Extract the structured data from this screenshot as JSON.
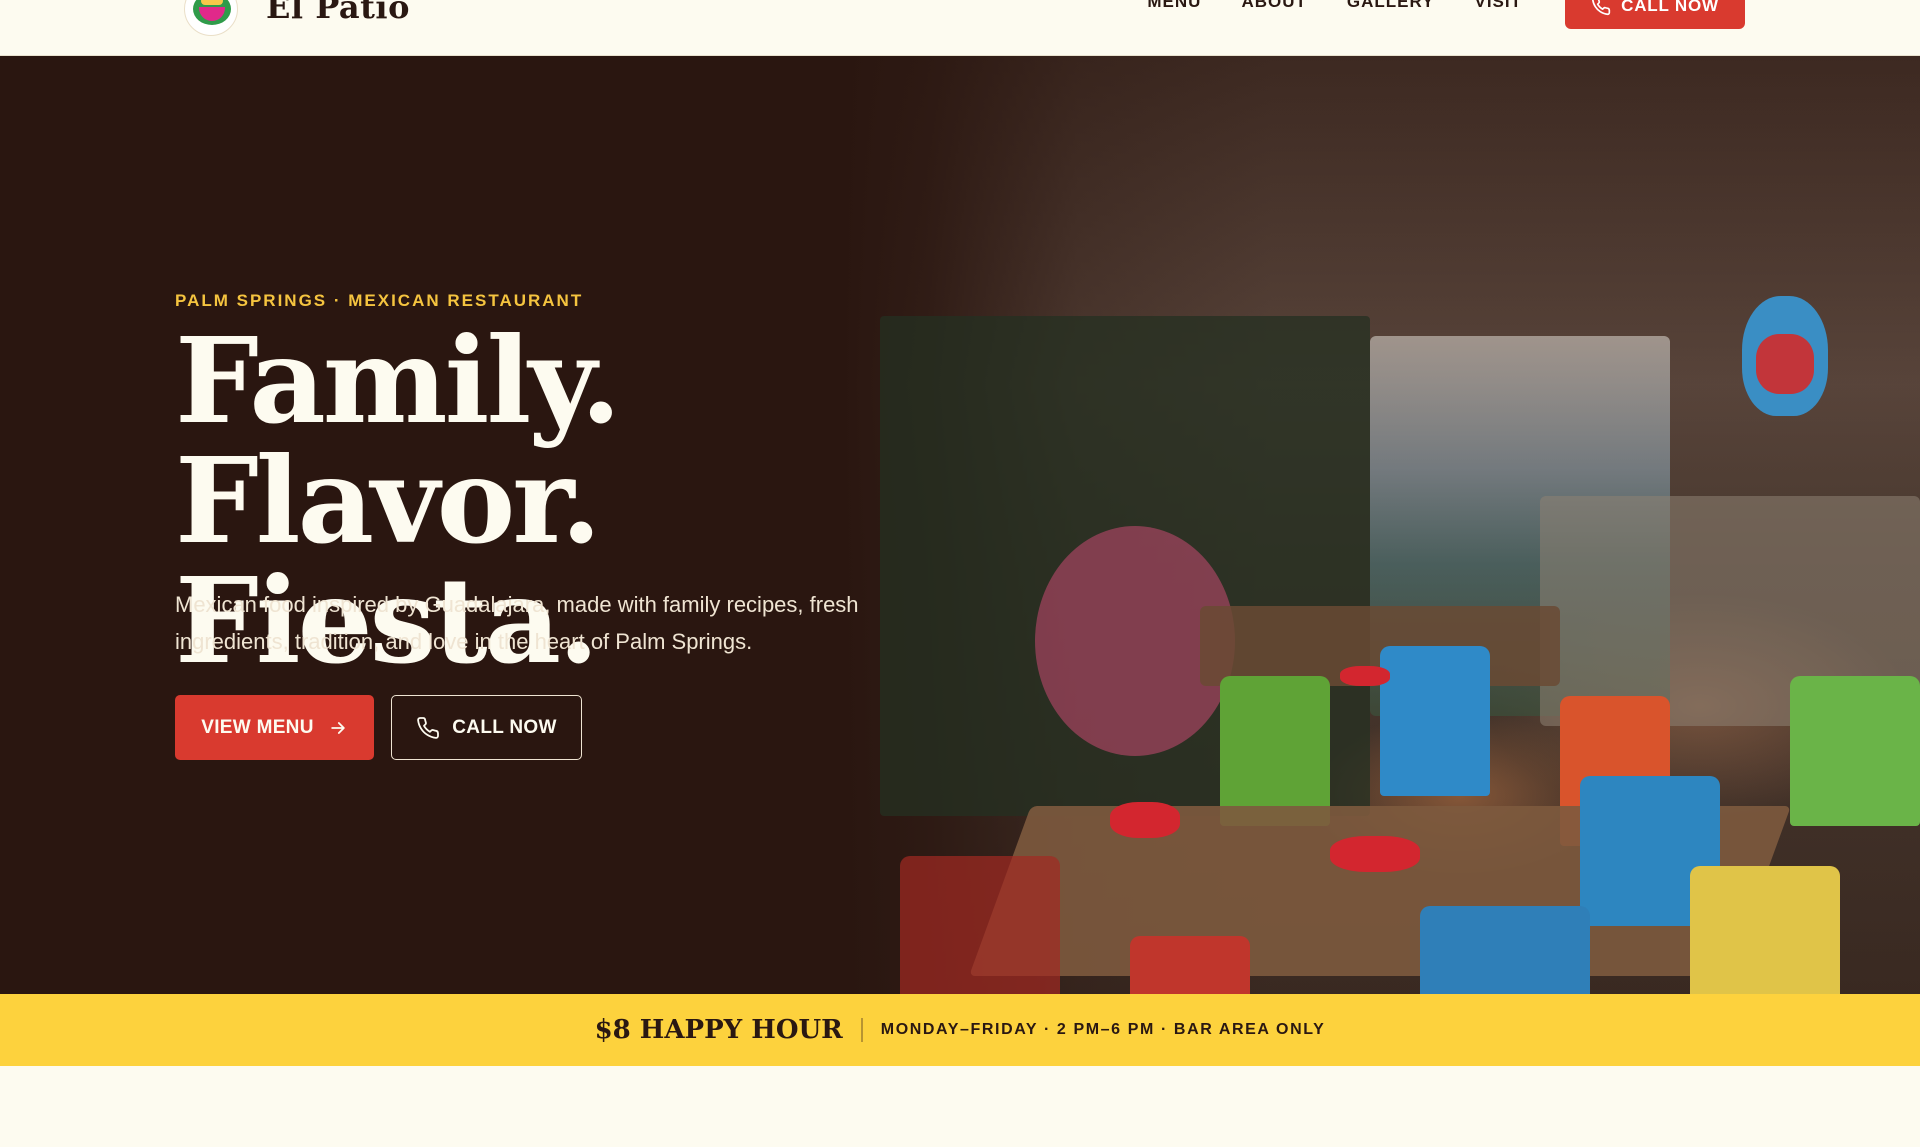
{
  "header": {
    "brand": "El Patio",
    "nav": [
      "MENU",
      "ABOUT",
      "GALLERY",
      "VISIT"
    ],
    "cta_label": "CALL NOW"
  },
  "hero": {
    "eyebrow": "PALM SPRINGS · MEXICAN RESTAURANT",
    "headline_line1": "Family. Flavor.",
    "headline_line2": "Fiesta.",
    "subcopy": "Mexican food inspired by Guadalajara, made with family recipes, fresh ingredients, tradition, and love in the heart of Palm Springs.",
    "primary_button": "VIEW MENU",
    "secondary_button": "CALL NOW"
  },
  "happy_hour": {
    "title": "$8 HAPPY HOUR",
    "detail": "MONDAY–FRIDAY · 2 PM–6 PM · BAR AREA ONLY"
  },
  "icons": {
    "header_cta": "phone-icon",
    "primary_button": "arrow-right-icon",
    "secondary_button": "phone-icon"
  },
  "colors": {
    "accent_red": "#d93a2f",
    "eyebrow_yellow": "#f5c43f",
    "strip_yellow": "#fdd23d",
    "hero_dark": "#2a1610",
    "cream": "#fdfbf0"
  }
}
